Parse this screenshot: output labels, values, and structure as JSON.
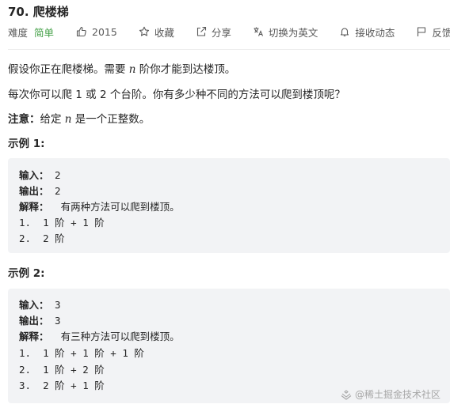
{
  "problem": {
    "title": "70. 爬楼梯"
  },
  "toolbar": {
    "difficulty_label": "难度",
    "difficulty_value": "简单",
    "likes": "2015",
    "favorite": "收藏",
    "share": "分享",
    "translate": "切换为英文",
    "subscribe": "接收动态",
    "feedback": "反馈"
  },
  "description": {
    "line1_a": "假设你正在爬楼梯。需要 ",
    "line1_var": "n",
    "line1_b": " 阶你才能到达楼顶。",
    "line2": "每次你可以爬 1 或 2 个台阶。你有多少种不同的方法可以爬到楼顶呢？",
    "note_label": "注意：",
    "note_a": "给定 ",
    "note_var": "n",
    "note_b": " 是一个正整数。"
  },
  "examples": [
    {
      "heading": "示例 1:",
      "input_label": "输入：",
      "input_value": " 2",
      "output_label": "输出：",
      "output_value": " 2",
      "explain_label": "解释：",
      "explain_value": "  有两种方法可以爬到楼顶。",
      "steps": [
        "1.  1 阶 + 1 阶",
        "2.  2 阶"
      ]
    },
    {
      "heading": "示例 2:",
      "input_label": "输入：",
      "input_value": " 3",
      "output_label": "输出：",
      "output_value": " 3",
      "explain_label": "解释：",
      "explain_value": "  有三种方法可以爬到楼顶。",
      "steps": [
        "1.  1 阶 + 1 阶 + 1 阶",
        "2.  1 阶 + 2 阶",
        "3.  2 阶 + 1 阶"
      ]
    }
  ],
  "watermark": "@稀土掘金技术社区"
}
